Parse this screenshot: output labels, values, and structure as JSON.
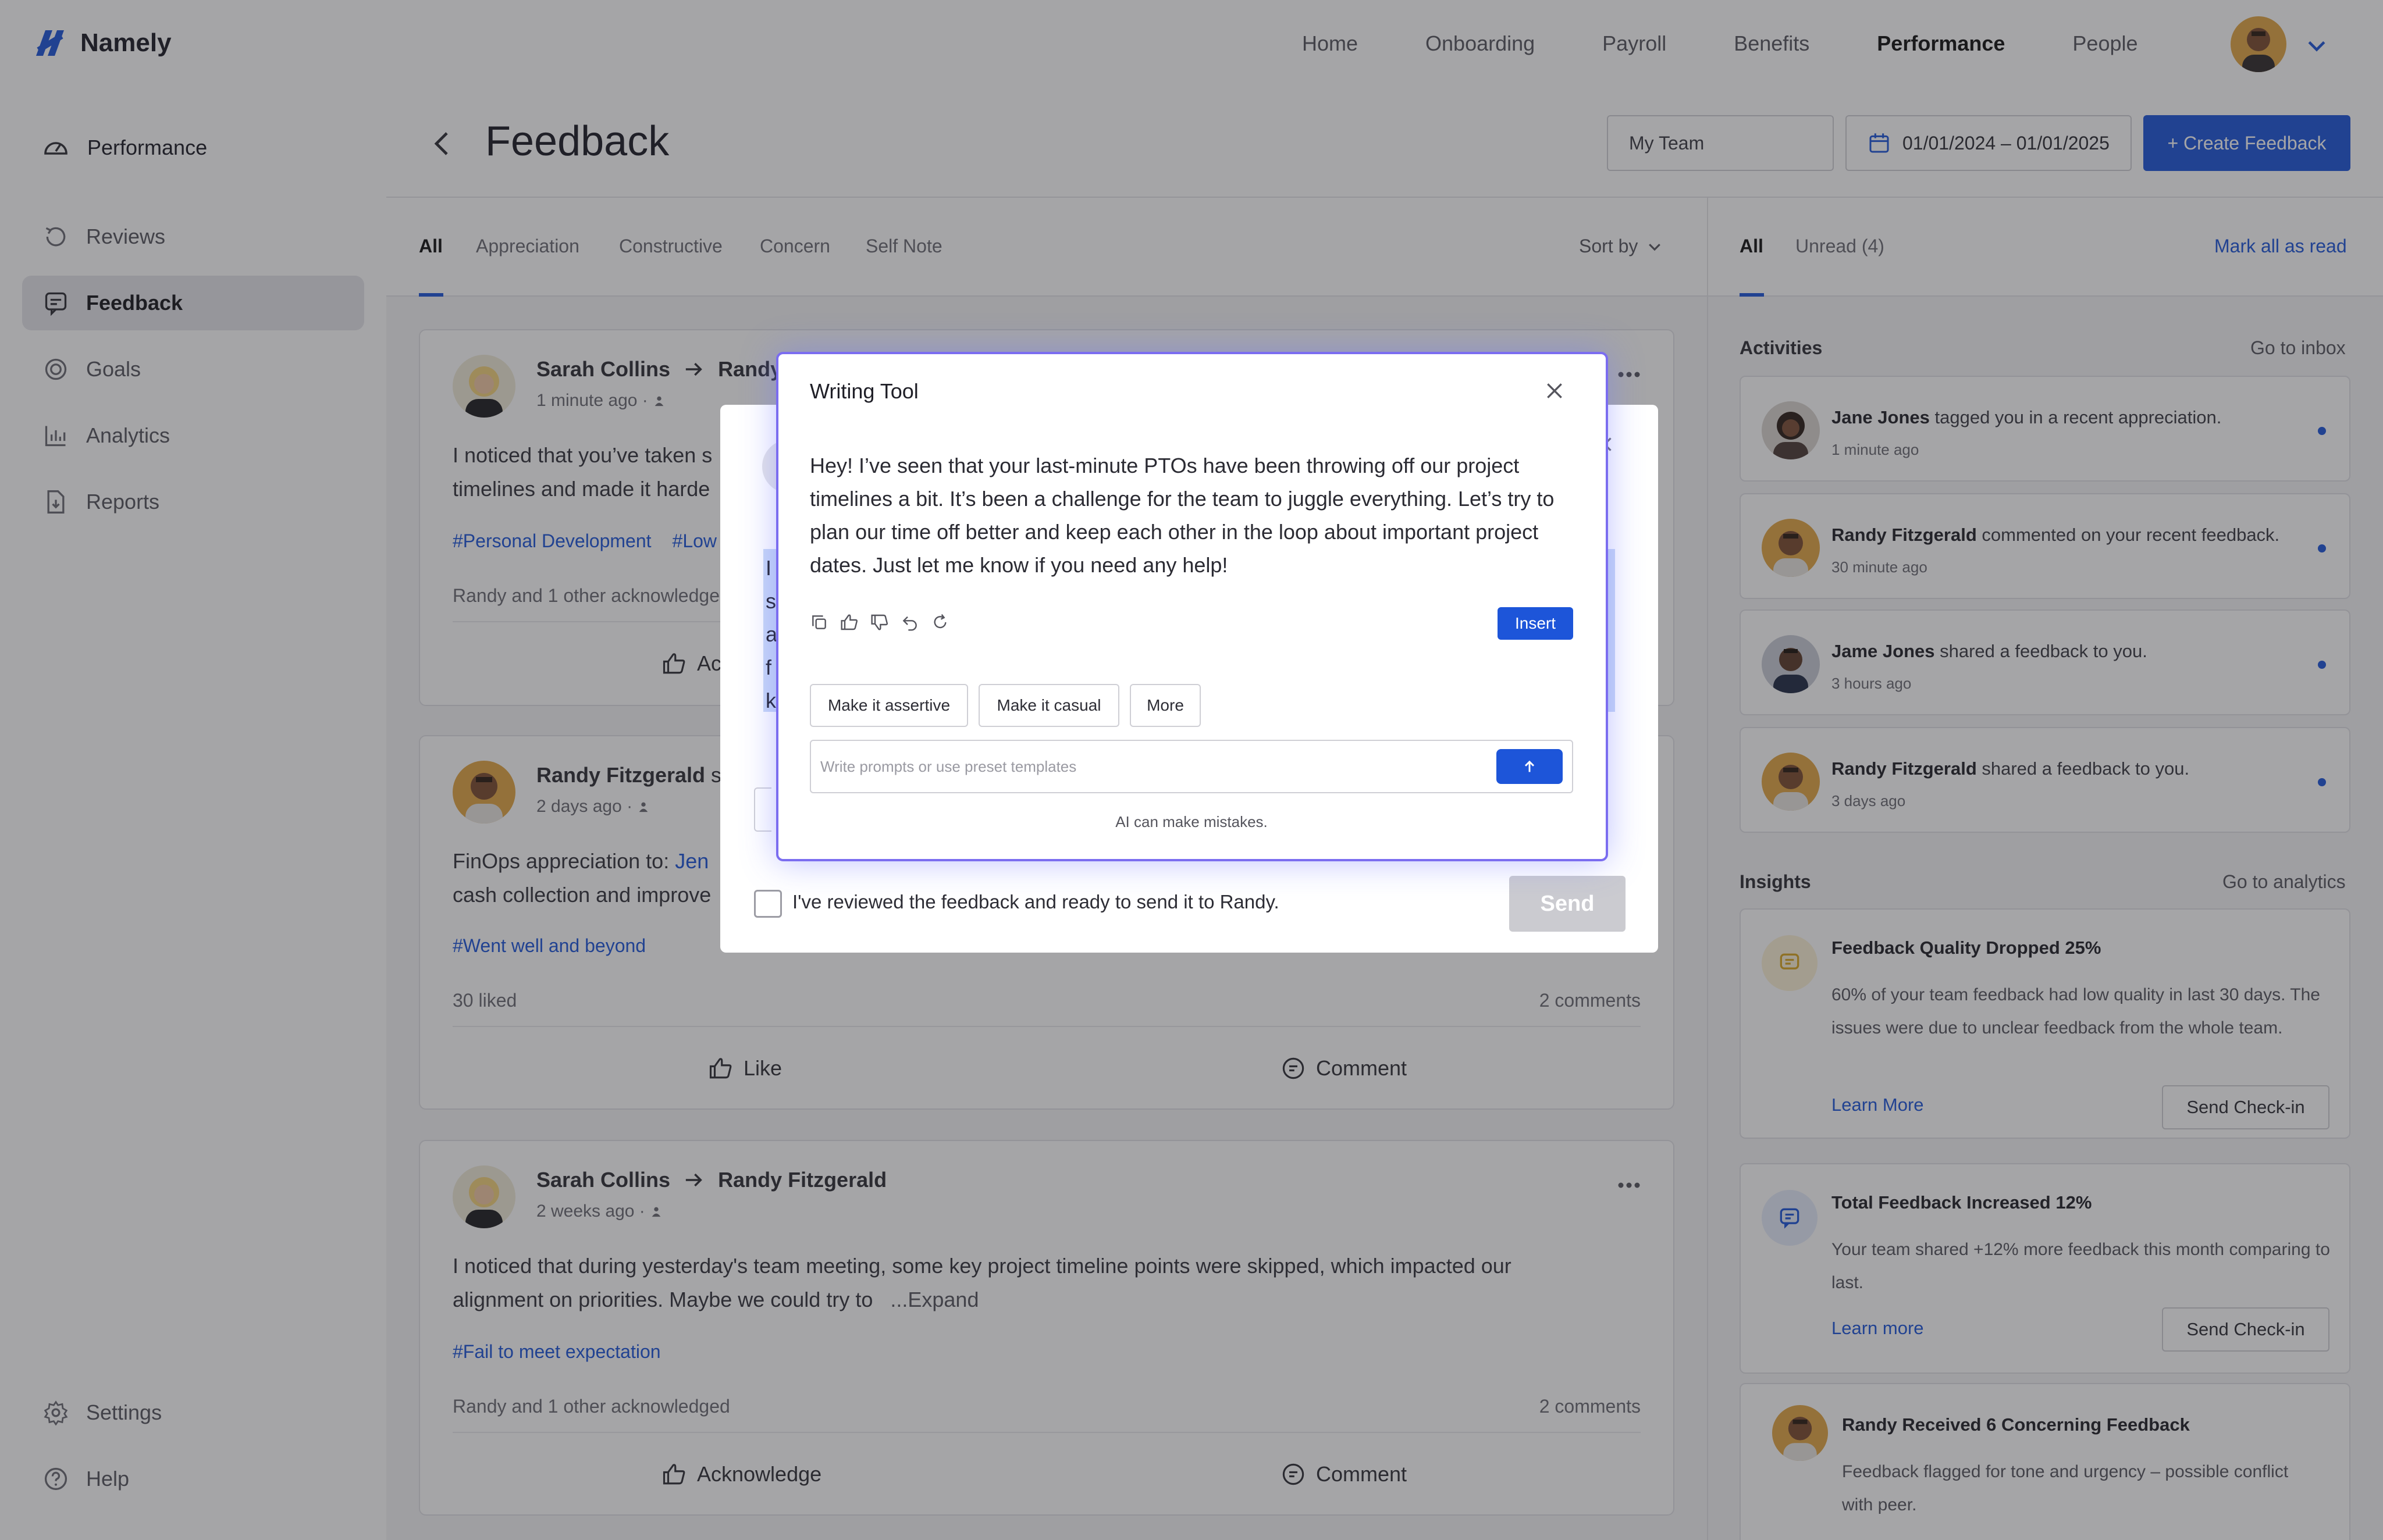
{
  "brand": {
    "name": "Namely",
    "accent": "#1d55d9"
  },
  "topnav": {
    "items": [
      "Home",
      "Onboarding",
      "Payroll",
      "Benefits",
      "Performance",
      "People"
    ],
    "active": "Performance"
  },
  "sidebar": {
    "header": "Performance",
    "items": [
      {
        "label": "Reviews",
        "icon": "reviews-icon"
      },
      {
        "label": "Feedback",
        "icon": "feedback-icon"
      },
      {
        "label": "Goals",
        "icon": "goals-icon"
      },
      {
        "label": "Analytics",
        "icon": "analytics-icon"
      },
      {
        "label": "Reports",
        "icon": "reports-icon"
      }
    ],
    "active": "Feedback",
    "bottom": [
      {
        "label": "Settings",
        "icon": "gear-icon"
      },
      {
        "label": "Help",
        "icon": "help-icon"
      }
    ]
  },
  "header": {
    "title": "Feedback",
    "team_select": "My Team",
    "date_range": "01/01/2024 – 01/01/2025",
    "create_label": "+ Create Feedback"
  },
  "feed": {
    "tabs": [
      "All",
      "Appreciation",
      "Constructive",
      "Concern",
      "Self Note"
    ],
    "active_tab": "All",
    "sort_label": "Sort by",
    "cards": [
      {
        "from": "Sarah Collins",
        "to": "Randy",
        "time": "1 minute ago ·",
        "body_line1": "I noticed that you’ve taken s",
        "body_line2": "timelines and made it harde",
        "tags": [
          "#Personal Development",
          "#Low"
        ],
        "stat_left": "Randy and 1 other acknowledge",
        "action_left": "Ac"
      },
      {
        "from": "Randy Fitzgerald",
        "verb": "sl",
        "time": "2 days ago ·",
        "body_line1_prefix": "FinOps appreciation to: ",
        "body_line1_link": "Jen",
        "body_line2": "cash collection and improve",
        "tags": [
          "#Went well and beyond"
        ],
        "stat_left": "30 liked",
        "stat_right": "2 comments",
        "action_left": "Like",
        "action_right": "Comment"
      },
      {
        "from": "Sarah Collins",
        "to": "Randy Fitzgerald",
        "time": "2 weeks ago ·",
        "body_line1": "I noticed that during yesterday's team meeting, some key project timeline points were skipped, which impacted our",
        "body_line2": "alignment on priorities. Maybe we could try to",
        "expand": "...Expand",
        "tags": [
          "#Fail to meet expectation"
        ],
        "stat_left": "Randy and 1 other acknowledged",
        "stat_right": "2 comments",
        "action_left": "Acknowledge",
        "action_right": "Comment"
      }
    ]
  },
  "right": {
    "tabs": [
      "All",
      "Unread (4)"
    ],
    "active_tab": "All",
    "mark_all": "Mark all as read",
    "activities_title": "Activities",
    "activities_link": "Go to inbox",
    "activities": [
      {
        "name": "Jane Jones",
        "text": " tagged you in a recent appreciation.",
        "time": "1 minute ago"
      },
      {
        "name": "Randy Fitzgerald",
        "text": " commented on your recent feedback.",
        "time": "30 minute ago"
      },
      {
        "name": "Jame Jones",
        "text": " shared a feedback to you.",
        "time": "3 hours ago"
      },
      {
        "name": "Randy Fitzgerald",
        "text": " shared a feedback to you.",
        "time": "3 days ago"
      }
    ],
    "insights_title": "Insights",
    "insights_link": "Go to analytics",
    "insights": [
      {
        "title": "Feedback Quality Dropped 25%",
        "desc": "60% of your team feedback had low quality in last 30 days. The issues were due to unclear feedback from the whole team.",
        "link": "Learn More",
        "button": "Send Check-in"
      },
      {
        "title": "Total Feedback Increased 12%",
        "desc": "Your team shared +12% more feedback this month comparing to last.",
        "link": "Learn more",
        "button": "Send Check-in"
      },
      {
        "title": "Randy Received 6 Concerning Feedback",
        "desc": "Feedback flagged for tone and urgency – possible conflict with peer."
      }
    ]
  },
  "review_modal": {
    "highlight_letters": "I\ns\na\nf\nk",
    "checkbox_label": "I've reviewed the feedback and ready to send it to Randy.",
    "send_label": "Send"
  },
  "writing_tool": {
    "title": "Writing Tool",
    "text": "Hey! I’ve seen that your last-minute PTOs have been throwing off our project timelines a bit. It’s been a challenge for the team to juggle everything. Let’s try to plan our time off better and keep each other in the loop about important project dates. Just let me know if you need any help!",
    "insert_label": "Insert",
    "chips": [
      "Make it assertive",
      "Make it casual",
      "More"
    ],
    "prompt_placeholder": "Write prompts or use preset templates",
    "disclaimer": "AI can make mistakes."
  }
}
